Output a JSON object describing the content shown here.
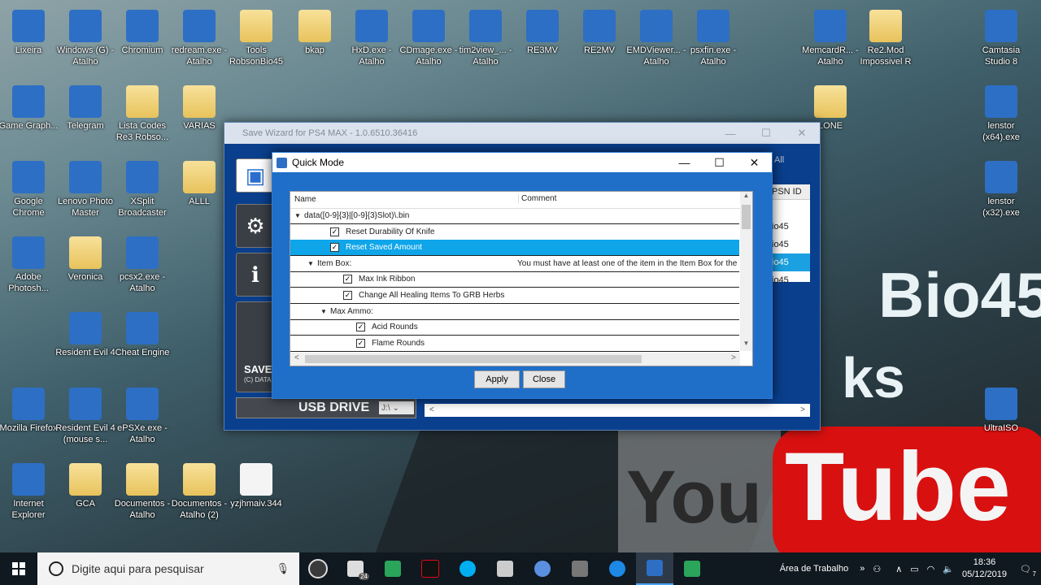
{
  "desktop": {
    "icons_col1": [
      {
        "label": "Lixeira",
        "kind": "app"
      },
      {
        "label": "Game Graph...",
        "kind": "app"
      },
      {
        "label": "Google Chrome",
        "kind": "app"
      },
      {
        "label": "Adobe Photosh...",
        "kind": "app"
      },
      {
        "label": "Mozilla Firefox",
        "kind": "app"
      },
      {
        "label": "Internet Explorer",
        "kind": "app"
      }
    ],
    "icons_col2": [
      {
        "label": "Windows (G) - Atalho",
        "kind": "app"
      },
      {
        "label": "Telegram",
        "kind": "app"
      },
      {
        "label": "Lenovo Photo Master",
        "kind": "app"
      },
      {
        "label": "Veronica",
        "kind": "folder"
      },
      {
        "label": "Resident Evil 4",
        "kind": "app"
      },
      {
        "label": "Resident Evil 4 (mouse s...",
        "kind": "app"
      },
      {
        "label": "GCA",
        "kind": "folder"
      }
    ],
    "icons_col3": [
      {
        "label": "Chromium",
        "kind": "app"
      },
      {
        "label": "Lista Codes Re3 Robso...",
        "kind": "folder"
      },
      {
        "label": "XSplit Broadcaster",
        "kind": "app"
      },
      {
        "label": "pcsx2.exe - Atalho",
        "kind": "app"
      },
      {
        "label": "Cheat Engine",
        "kind": "app"
      },
      {
        "label": "ePSXe.exe - Atalho",
        "kind": "app"
      },
      {
        "label": "Documentos - Atalho",
        "kind": "folder"
      }
    ],
    "icons_top": [
      {
        "label": "redream.exe - Atalho",
        "kind": "app"
      },
      {
        "label": "Tools RobsonBio45",
        "kind": "folder"
      },
      {
        "label": "bkap",
        "kind": "folder"
      },
      {
        "label": "HxD.exe - Atalho",
        "kind": "app"
      },
      {
        "label": "CDmage.exe - Atalho",
        "kind": "app"
      },
      {
        "label": "tim2view_... - Atalho",
        "kind": "app"
      },
      {
        "label": "RE3MV",
        "kind": "app"
      },
      {
        "label": "RE2MV",
        "kind": "app"
      },
      {
        "label": "EMDViewer... - Atalho",
        "kind": "app"
      },
      {
        "label": "psxfin.exe - Atalho",
        "kind": "app"
      },
      {
        "label": "MemcardR... - Atalho",
        "kind": "app"
      },
      {
        "label": "Re2.Mod Impossivel R",
        "kind": "folder"
      },
      {
        "label": "Camtasia Studio 8",
        "kind": "app"
      }
    ],
    "icons_misc": [
      {
        "label": "VARIAS",
        "kind": "folder"
      },
      {
        "label": "ALLL",
        "kind": "folder"
      },
      {
        "label": "LONE",
        "kind": "folder"
      },
      {
        "label": "Documentos - Atalho (2)",
        "kind": "folder"
      },
      {
        "label": "yzjhmaiv.344",
        "kind": "file"
      },
      {
        "label": "lenstor (x64).exe",
        "kind": "app"
      },
      {
        "label": "lenstor (x32).exe",
        "kind": "app"
      },
      {
        "label": "UltraISO",
        "kind": "app"
      }
    ],
    "wallpaper_text": {
      "a": "Bio45",
      "b": "ks",
      "c": "You",
      "d": "Tube"
    }
  },
  "main_window": {
    "title": "Save Wizard for PS4 MAX - 1.0.6510.36416",
    "all_link": "All",
    "psn_header": "PSN ID",
    "psn_rows": [
      "",
      "io45",
      "io45",
      "io45",
      "io45"
    ],
    "save_label": "SAVE",
    "save_sub": "(C) DATA",
    "usb_label": "USB DRIVE",
    "usb_drive": "J:\\"
  },
  "dialog": {
    "title": "Quick Mode",
    "col_name": "Name",
    "col_comment": "Comment",
    "rows": [
      {
        "indent": 0,
        "expander": "▼",
        "checkbox": false,
        "text": "data([0-9]{3}|[0-9]{3}Slot)\\.bin",
        "comment": "",
        "selected": false
      },
      {
        "indent": 1,
        "expander": "",
        "checkbox": true,
        "text": "Reset Durability Of Knife",
        "comment": "",
        "selected": false
      },
      {
        "indent": 1,
        "expander": "",
        "checkbox": true,
        "text": "Reset Saved Amount",
        "comment": "",
        "selected": true
      },
      {
        "indent": 1,
        "expander": "▼",
        "checkbox": false,
        "text": "Item Box:",
        "comment": "You must have at least one of the item in the Item Box for the c",
        "selected": false
      },
      {
        "indent": 2,
        "expander": "",
        "checkbox": true,
        "text": "Max Ink Ribbon",
        "comment": "",
        "selected": false
      },
      {
        "indent": 2,
        "expander": "",
        "checkbox": true,
        "text": "Change All Healing Items To GRB Herbs",
        "comment": "",
        "selected": false
      },
      {
        "indent": 2,
        "expander": "▼",
        "checkbox": false,
        "text": "Max Ammo:",
        "comment": "",
        "selected": false
      },
      {
        "indent": 3,
        "expander": "",
        "checkbox": true,
        "text": "Acid Rounds",
        "comment": "",
        "selected": false
      },
      {
        "indent": 3,
        "expander": "",
        "checkbox": true,
        "text": "Flame Rounds",
        "comment": "",
        "selected": false
      }
    ],
    "apply_label": "Apply",
    "close_label": "Close"
  },
  "taskbar": {
    "search_placeholder": "Digite aqui para pesquisar",
    "desktop_label": "Área de Trabalho",
    "time": "18:36",
    "date": "05/12/2019",
    "notif_count": "7",
    "badge": "24"
  },
  "colors": {
    "accent": "#0ea5e9",
    "dialog_frame": "#1f6fc9",
    "window_bg": "#0a3f8d"
  }
}
